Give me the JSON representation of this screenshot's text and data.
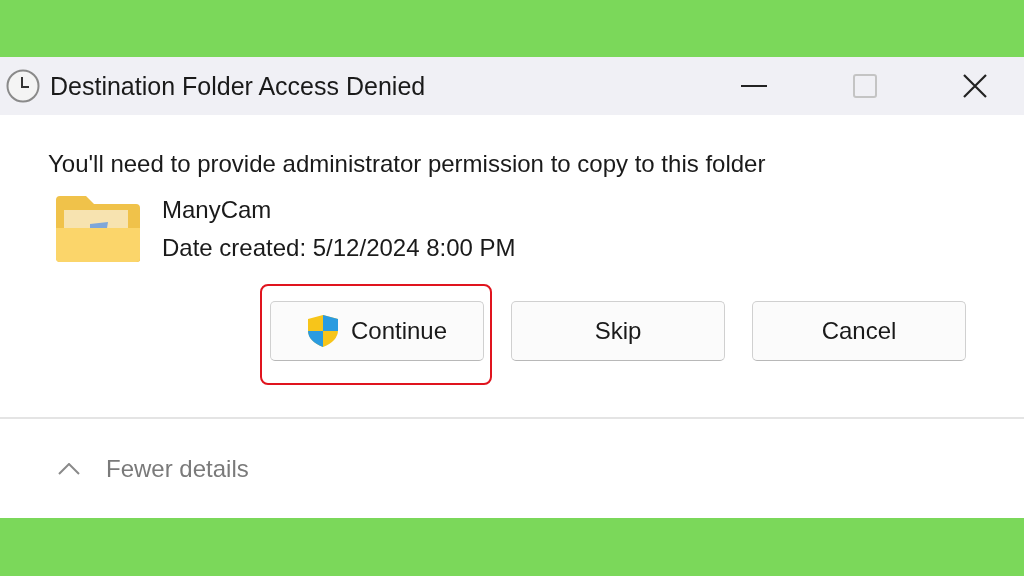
{
  "window": {
    "title": "Destination Folder Access Denied",
    "maximize_disabled": true
  },
  "message": "You'll need to provide administrator permission to copy to this folder",
  "item": {
    "name": "ManyCam",
    "date": "Date created: 5/12/2024 8:00 PM"
  },
  "buttons": [
    {
      "label": "Continue",
      "kind": "shield",
      "highlighted": true
    },
    {
      "label": "Skip",
      "kind": "plain",
      "highlighted": false
    },
    {
      "label": "Cancel",
      "kind": "plain",
      "highlighted": false
    }
  ],
  "details_toggle": {
    "label": "Fewer details",
    "expanded": true
  }
}
